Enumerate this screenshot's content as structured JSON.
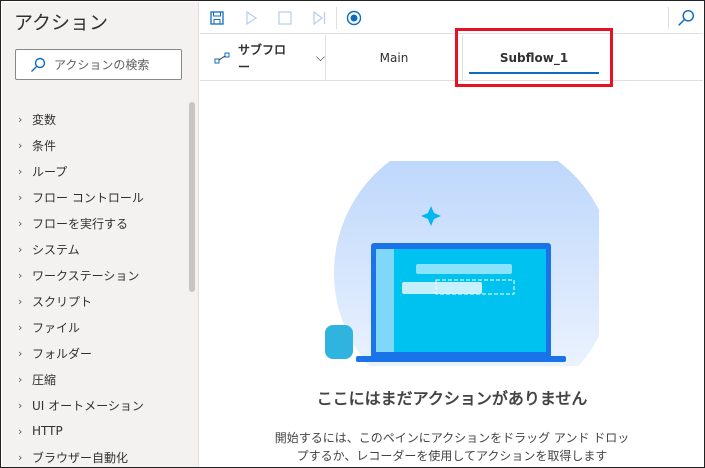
{
  "sidebar": {
    "title": "アクション",
    "search_placeholder": "アクションの検索",
    "items": [
      "変数",
      "条件",
      "ループ",
      "フロー コントロール",
      "フローを実行する",
      "システム",
      "ワークステーション",
      "スクリプト",
      "ファイル",
      "フォルダー",
      "圧縮",
      "UI オートメーション",
      "HTTP",
      "ブラウザー自動化"
    ]
  },
  "toolbar": {
    "icons": [
      "save-icon",
      "run-icon",
      "stop-icon",
      "step-icon",
      "record-icon",
      "search-icon"
    ]
  },
  "tabs": {
    "subflow_label": "サブフロー",
    "items": [
      "Main",
      "Subflow_1"
    ],
    "active": "Subflow_1"
  },
  "empty": {
    "title": "ここにはまだアクションがありません",
    "desc_line1": "開始するには、このペインにアクションをドラッグ アンド ドロッ",
    "desc_line2": "プするか、レコーダーを使用してアクションを取得します"
  },
  "colors": {
    "accent": "#0f6cbd",
    "highlight": "#e81123"
  }
}
